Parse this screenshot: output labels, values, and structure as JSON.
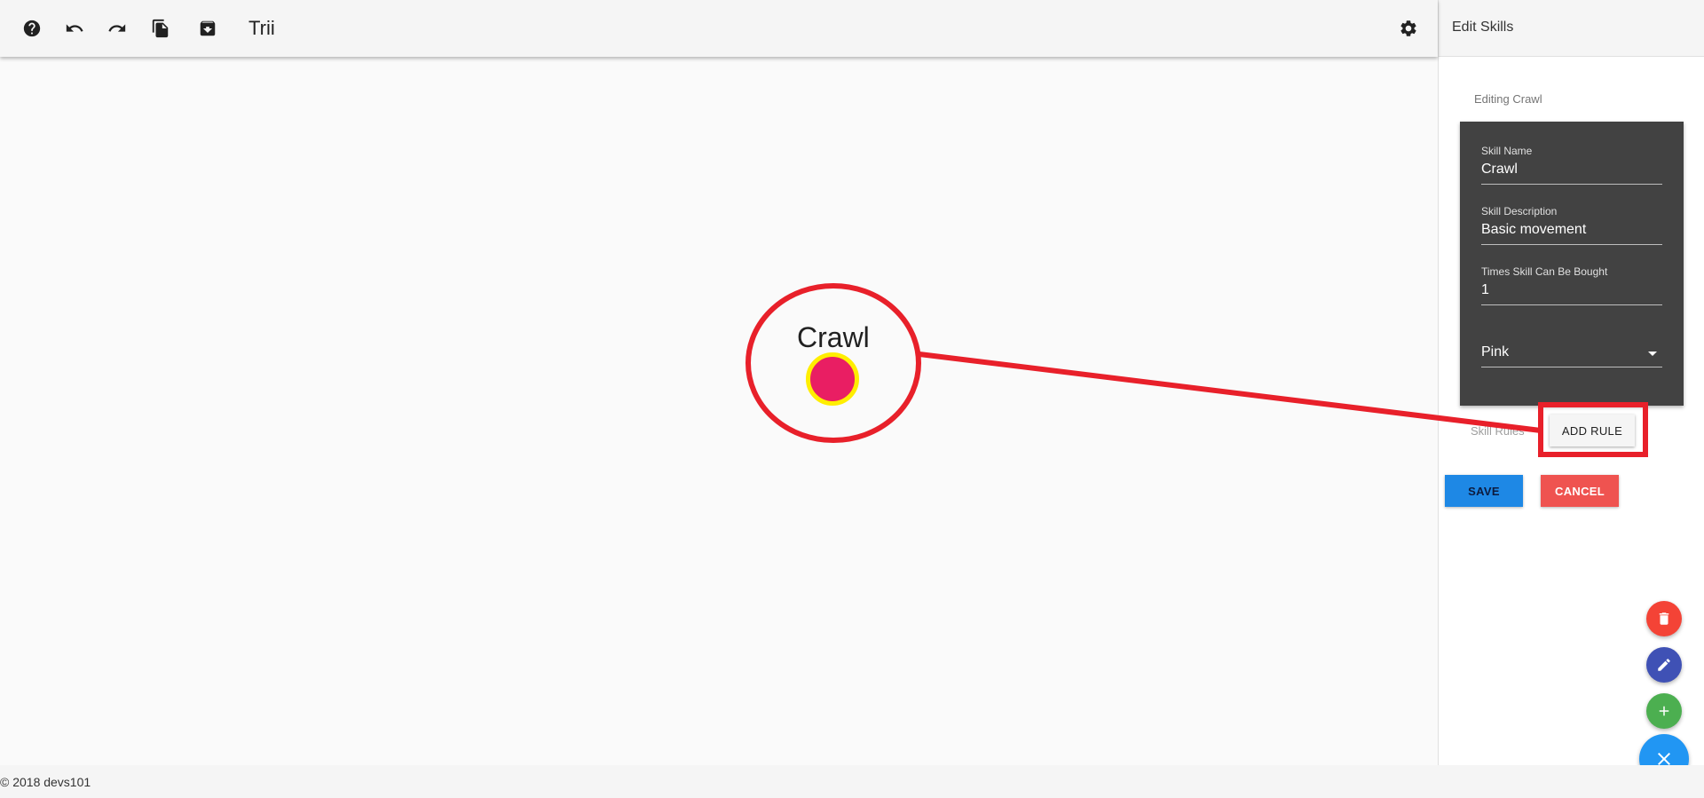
{
  "toolbar": {
    "title": "Trii",
    "buttons": [
      {
        "icon": "help-icon"
      },
      {
        "icon": "undo-icon"
      },
      {
        "icon": "redo-icon"
      },
      {
        "icon": "file-copy-icon"
      },
      {
        "icon": "archive-icon"
      }
    ],
    "settings_icon": "gear-icon"
  },
  "canvas": {
    "node": {
      "label": "Crawl",
      "fill_color": "#e91e63",
      "ring_color": "#ffee00"
    }
  },
  "panel": {
    "title": "Edit Skills",
    "editing_label": "Editing Crawl",
    "fields": {
      "skill_name": {
        "label": "Skill Name",
        "value": "Crawl"
      },
      "skill_description": {
        "label": "Skill Description",
        "value": "Basic movement"
      },
      "times_bought": {
        "label": "Times Skill Can Be Bought",
        "value": "1"
      },
      "color": {
        "value": "Pink"
      }
    },
    "skill_rules_label": "Skill Rules",
    "add_rule_label": "ADD RULE",
    "save_label": "SAVE",
    "cancel_label": "CANCEL"
  },
  "fabs": [
    {
      "icon": "trash-icon",
      "color": "#f44336"
    },
    {
      "icon": "pencil-icon",
      "color": "#3f51b5"
    },
    {
      "icon": "plus-icon",
      "color": "#4caf50"
    },
    {
      "icon": "close-icon",
      "color": "#2196f3"
    }
  ],
  "footer": {
    "text": "© 2018 devs101"
  },
  "annotation": {
    "color": "#e8202a"
  }
}
